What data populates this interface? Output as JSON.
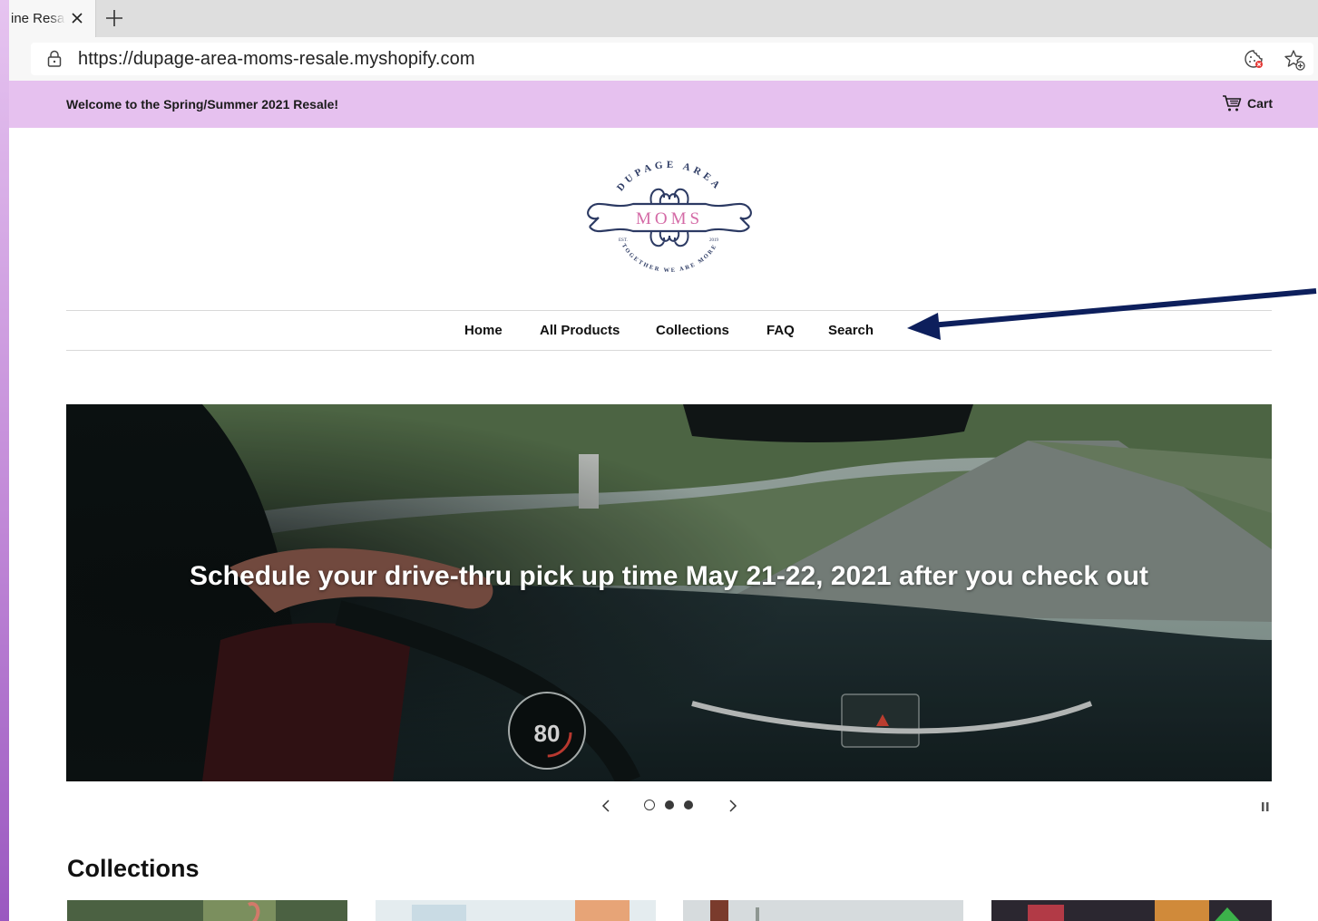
{
  "browser": {
    "tab_title": "ine Resal",
    "url": "https://dupage-area-moms-resale.myshopify.com"
  },
  "announcement": {
    "text": "Welcome to the Spring/Summer 2021 Resale!",
    "cart_label": "Cart"
  },
  "logo": {
    "top_text": "DUPAGE AREA",
    "name": "MOMS",
    "est_label": "EST.",
    "year": "2019",
    "tagline": "TOGETHER WE ARE MORE"
  },
  "nav": {
    "items": [
      "Home",
      "All Products",
      "Collections",
      "FAQ",
      "Search"
    ]
  },
  "hero": {
    "caption": "Schedule your drive-thru pick up time May 21-22, 2021 after you check out",
    "speed_reading": "80",
    "slide_count": 3,
    "active_slide": 1
  },
  "collections": {
    "title": "Collections"
  },
  "colors": {
    "announcement_bg": "#e6c1ef",
    "logo_navy": "#2c3a63",
    "logo_pink": "#d46aa6",
    "annotation_arrow": "#0d1f5c"
  }
}
